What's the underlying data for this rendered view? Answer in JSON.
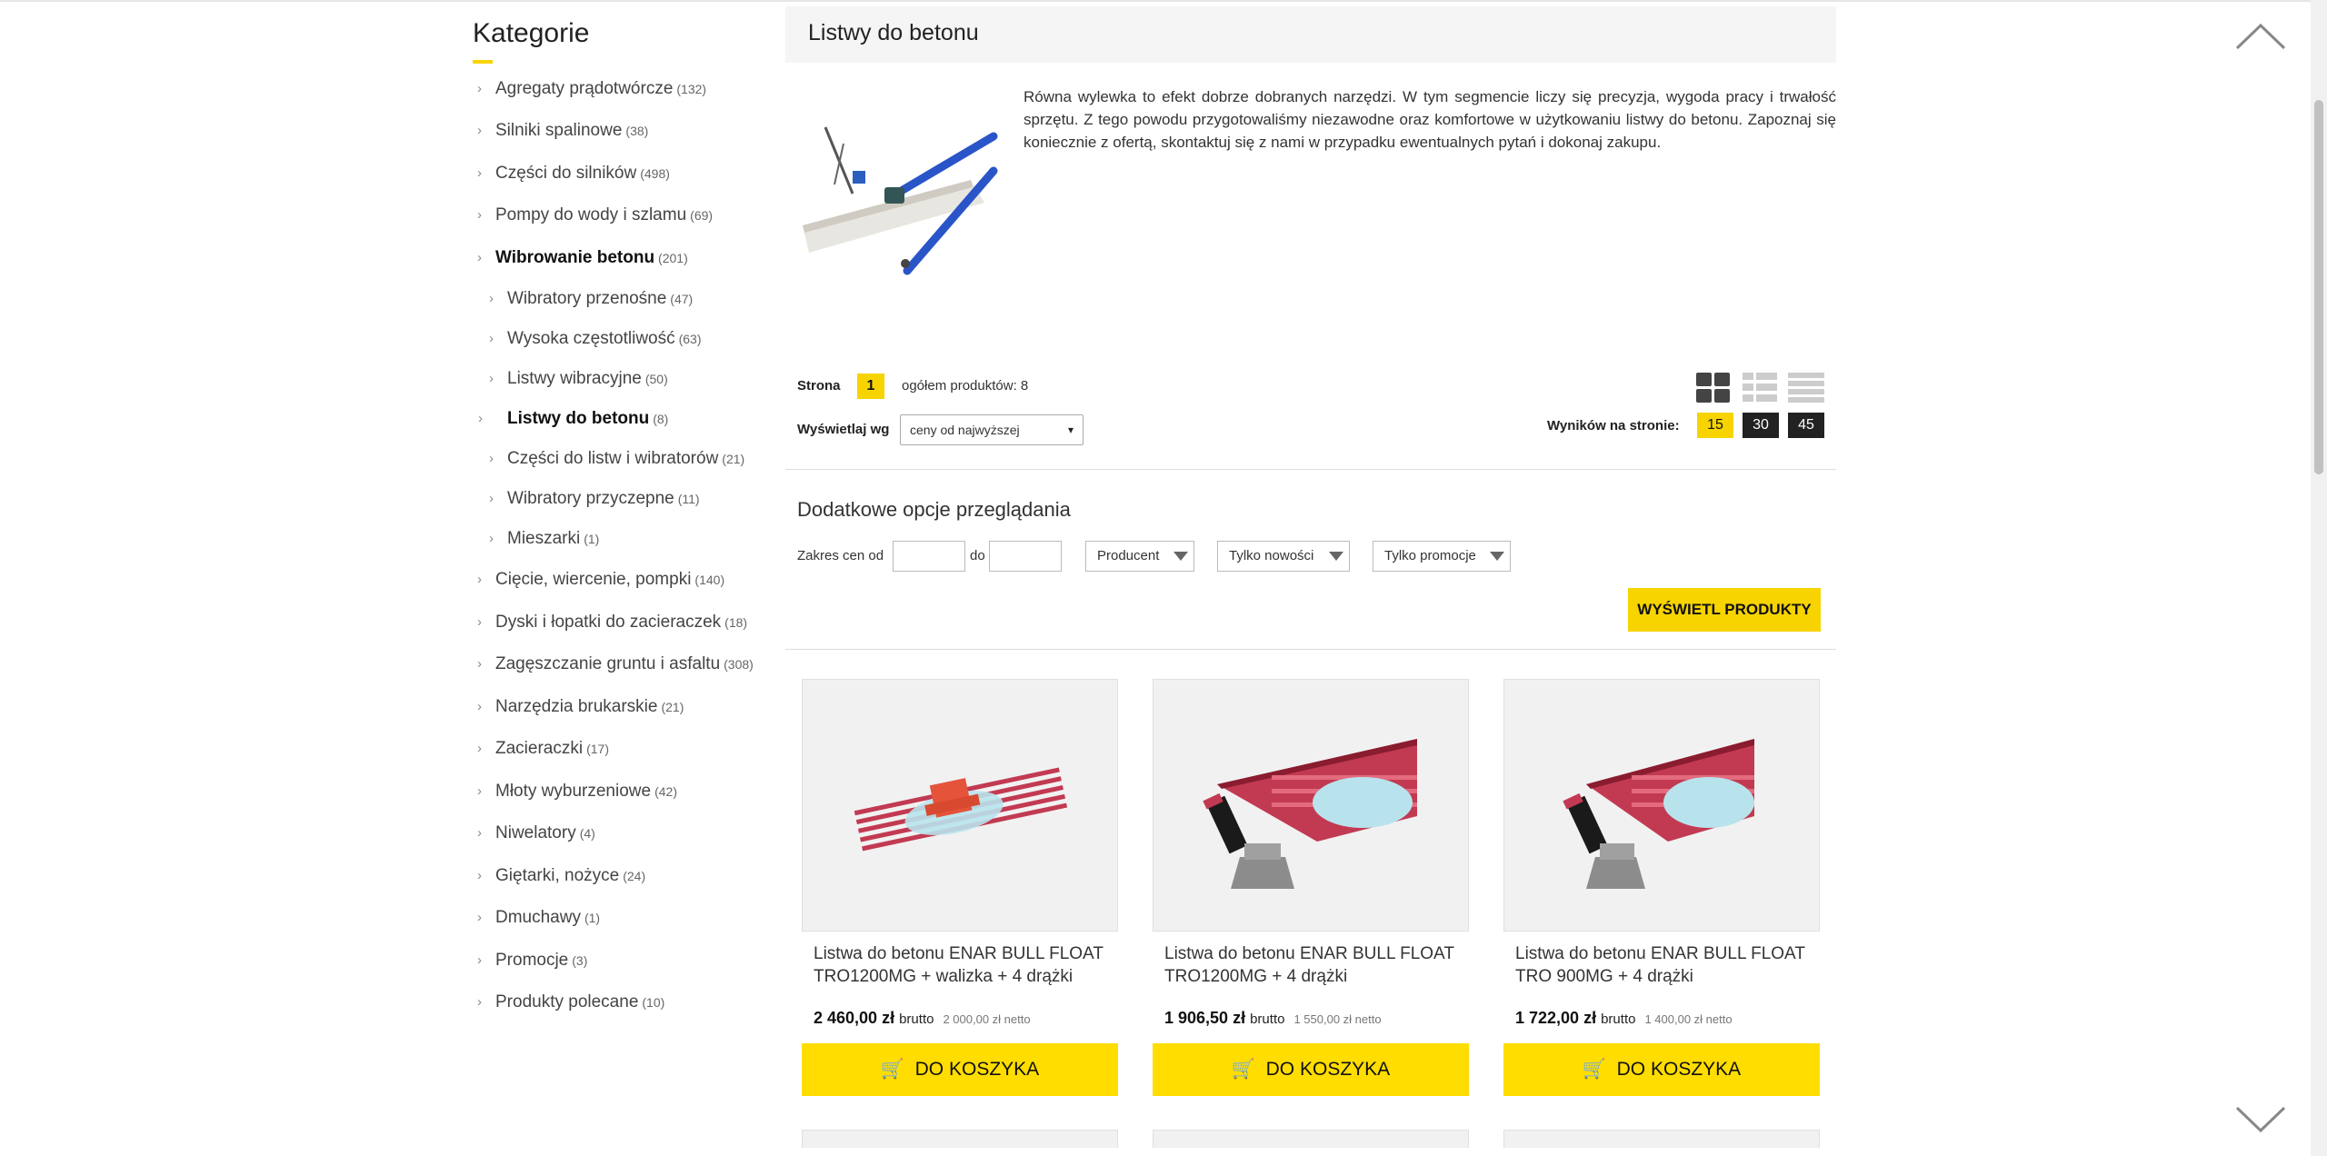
{
  "sidebar": {
    "title": "Kategorie",
    "items": [
      {
        "label": "Agregaty prądotwórcze",
        "count": "(132)"
      },
      {
        "label": "Silniki spalinowe",
        "count": "(38)"
      },
      {
        "label": "Części do silników",
        "count": "(498)"
      },
      {
        "label": "Pompy do wody i szlamu",
        "count": "(69)"
      },
      {
        "label": "Wibrowanie betonu",
        "count": "(201)"
      },
      {
        "label": "Wibratory przenośne",
        "count": "(47)"
      },
      {
        "label": "Wysoka częstotliwość",
        "count": "(63)"
      },
      {
        "label": "Listwy wibracyjne",
        "count": "(50)"
      },
      {
        "label": "Listwy do betonu",
        "count": "(8)"
      },
      {
        "label": "Części do listw i wibratorów",
        "count": "(21)"
      },
      {
        "label": "Wibratory przyczepne",
        "count": "(11)"
      },
      {
        "label": "Mieszarki",
        "count": "(1)"
      },
      {
        "label": "Cięcie, wiercenie, pompki",
        "count": "(140)"
      },
      {
        "label": "Dyski i łopatki do zacieraczek",
        "count": "(18)"
      },
      {
        "label": "Zagęszczanie gruntu i asfaltu",
        "count": "(308)"
      },
      {
        "label": "Narzędzia brukarskie",
        "count": "(21)"
      },
      {
        "label": "Zacieraczki",
        "count": "(17)"
      },
      {
        "label": "Młoty wyburzeniowe",
        "count": "(42)"
      },
      {
        "label": "Niwelatory",
        "count": "(4)"
      },
      {
        "label": "Giętarki, nożyce",
        "count": "(24)"
      },
      {
        "label": "Dmuchawy",
        "count": "(1)"
      },
      {
        "label": "Promocje",
        "count": "(3)"
      },
      {
        "label": "Produkty polecane",
        "count": "(10)"
      }
    ]
  },
  "main": {
    "title": "Listwy do betonu",
    "description": "Równa wylewka to efekt dobrze dobranych narzędzi. W tym segmencie liczy się precyzja, wygoda pracy i trwałość sprzętu. Z tego powodu przygotowaliśmy niezawodne oraz komfortowe w użytkowaniu listwy do betonu. Zapoznaj się koniecznie z ofertą, skontaktuj się z nami w przypadku ewentualnych pytań i dokonaj zakupu."
  },
  "paging": {
    "page_label": "Strona",
    "current_page": "1",
    "total_label": "ogółem produktów: 8",
    "sort_label": "Wyświetlaj wg",
    "sort_value": "ceny od najwyższej",
    "per_page_label": "Wyników na stronie:",
    "per_page_options": [
      "15",
      "30",
      "45"
    ]
  },
  "filters": {
    "title": "Dodatkowe opcje przeglądania",
    "price_from_label": "Zakres cen od",
    "price_to_label": "do",
    "producer": "Producent",
    "only_new": "Tylko nowości",
    "only_promo": "Tylko promocje",
    "submit": "WYŚWIETL PRODUKTY"
  },
  "products": [
    {
      "name": "Listwa do betonu ENAR BULL FLOAT TRO1200MG + walizka + 4 drążki",
      "price": "2 460,00 zł",
      "brutto": "brutto",
      "netto": "2 000,00 zł netto",
      "cart": "DO KOSZYKA"
    },
    {
      "name": "Listwa do betonu ENAR BULL FLOAT TRO1200MG + 4 drążki",
      "price": "1 906,50 zł",
      "brutto": "brutto",
      "netto": "1 550,00 zł netto",
      "cart": "DO KOSZYKA"
    },
    {
      "name": "Listwa do betonu ENAR BULL FLOAT TRO 900MG + 4 drążki",
      "price": "1 722,00 zł",
      "brutto": "brutto",
      "netto": "1 400,00 zł netto",
      "cart": "DO KOSZYKA"
    }
  ],
  "colors": {
    "accent": "#f7d400",
    "dark": "#222222"
  }
}
